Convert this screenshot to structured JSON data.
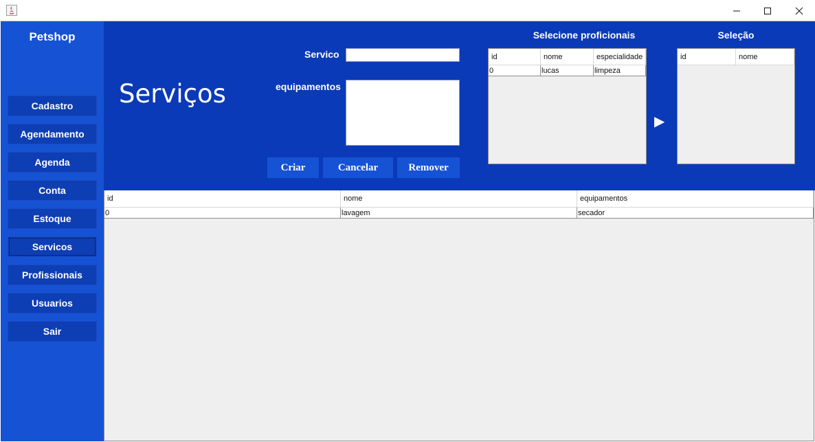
{
  "window": {
    "close_glyph": "✕",
    "maximize_glyph": "☐",
    "minimize_glyph": "—"
  },
  "sidebar": {
    "title": "Petshop",
    "items": [
      {
        "label": "Cadastro"
      },
      {
        "label": "Agendamento"
      },
      {
        "label": "Agenda"
      },
      {
        "label": "Conta"
      },
      {
        "label": "Estoque"
      },
      {
        "label": "Servicos"
      },
      {
        "label": "Profissionais"
      },
      {
        "label": "Usuarios"
      },
      {
        "label": "Sair"
      }
    ]
  },
  "header": {
    "title": "Serviços",
    "servico_label": "Servico",
    "servico_value": "",
    "equipamentos_label": "equipamentos",
    "equipamentos_value": "",
    "buttons": {
      "criar": "Criar",
      "cancelar": "Cancelar",
      "remover": "Remover"
    },
    "profissionais_title": "Selecione proficionais",
    "selecao_title": "Seleção",
    "arrow_glyph": "▶"
  },
  "profissionais_table": {
    "columns": [
      "id",
      "nome",
      "especialidade"
    ],
    "rows": [
      [
        "0",
        "lucas",
        "limpeza"
      ]
    ]
  },
  "selecao_table": {
    "columns": [
      "id",
      "nome"
    ],
    "rows": []
  },
  "servicos_table": {
    "columns": [
      "id",
      "nome",
      "equipamentos"
    ],
    "rows": [
      [
        "0",
        "lavagem",
        "secador"
      ]
    ]
  },
  "colors": {
    "sidebar": "#1652d4",
    "header": "#0a3ab7",
    "nav_button": "#0e3eb3",
    "action_button": "#1652d4",
    "table_background": "#efefef"
  }
}
